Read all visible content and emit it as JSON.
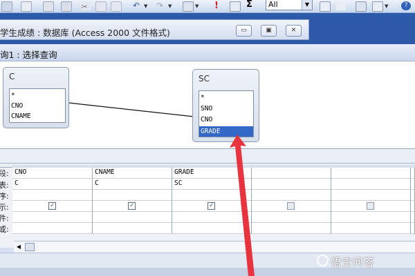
{
  "toolbar": {
    "filter_value": "All",
    "sigma": "Σ"
  },
  "db_window": {
    "title": "学生成绩 : 数据库 (Access 2000 文件格式)",
    "min_glyph": "▭",
    "restore_glyph": "▣",
    "close_glyph": "✕"
  },
  "query_window": {
    "title": "询1 : 选择查询"
  },
  "tables": [
    {
      "name": "C",
      "fields": [
        "*",
        "CNO",
        "CNAME"
      ]
    },
    {
      "name": "SC",
      "fields": [
        "*",
        "SNO",
        "CNO",
        "GRADE"
      ],
      "selected_field": "GRADE"
    }
  ],
  "grid": {
    "row_labels": [
      "段:",
      "表:",
      "序:",
      "示:",
      "件:",
      "或:"
    ],
    "columns": [
      {
        "field": "CNO",
        "table": "C",
        "show": true
      },
      {
        "field": "CNAME",
        "table": "C",
        "show": true
      },
      {
        "field": "GRADE",
        "table": "SC",
        "show": true
      },
      {
        "field": "",
        "table": "",
        "show": false
      },
      {
        "field": "",
        "table": "",
        "show": false
      },
      {
        "field": "",
        "table": "",
        "show": false
      }
    ]
  },
  "colors": {
    "annotation_arrow": "#e8343f",
    "selection": "#3468c6"
  },
  "watermark": {
    "text": "悟空问答"
  }
}
